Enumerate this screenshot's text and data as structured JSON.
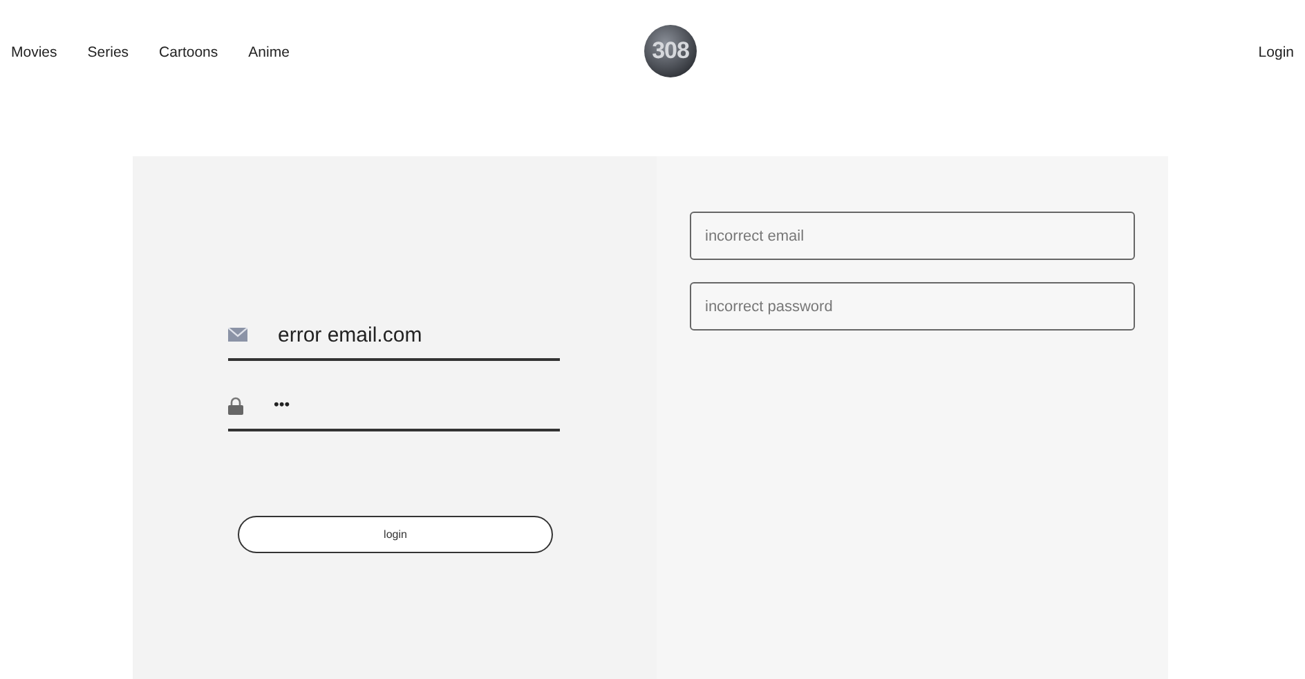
{
  "nav": {
    "links": [
      "Movies",
      "Series",
      "Cartoons",
      "Anime"
    ],
    "logo": "308",
    "login_link": "Login"
  },
  "form": {
    "email": {
      "value": "error email.com"
    },
    "password": {
      "value": "•••"
    },
    "button": "login"
  },
  "errors": [
    "incorrect email",
    "incorrect password"
  ]
}
